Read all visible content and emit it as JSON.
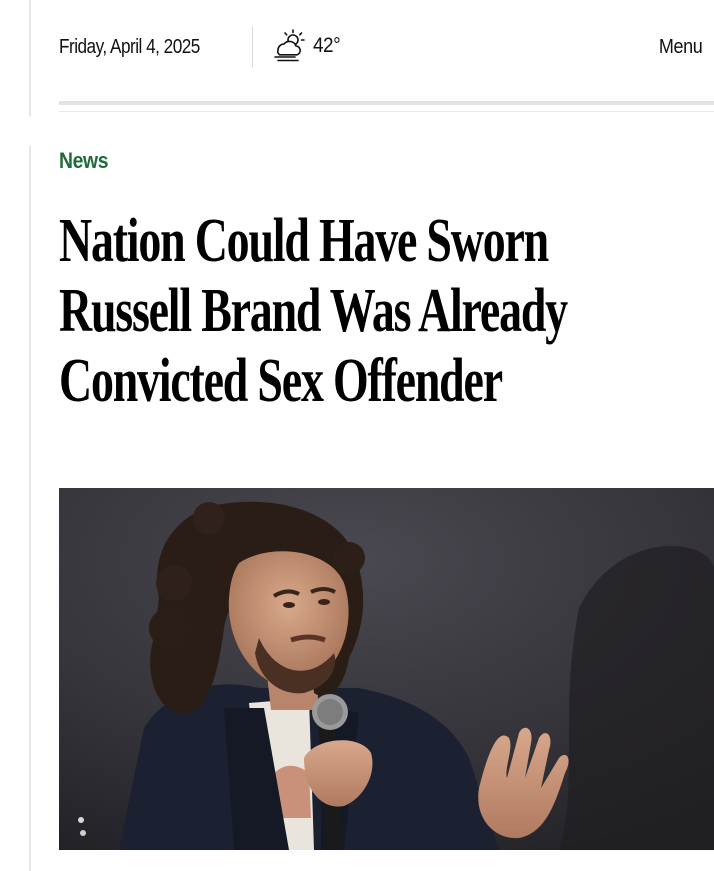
{
  "header": {
    "date": "Friday, April 4, 2025",
    "weather_icon": "partly-cloudy-sun-icon",
    "temperature": "42°",
    "menu_label": "Menu"
  },
  "article": {
    "section": "News",
    "headline_lines": [
      "Nation Could Have Sworn",
      "Russell Brand Was Already",
      "Convicted Sex Offender"
    ],
    "image": "photo of a man with long curly hair holding a microphone and gesturing"
  },
  "colors": {
    "section_green": "#1f6b3a",
    "text": "#000000",
    "rules": "#e3e3e3",
    "photo_background": "#2b2a2f"
  }
}
